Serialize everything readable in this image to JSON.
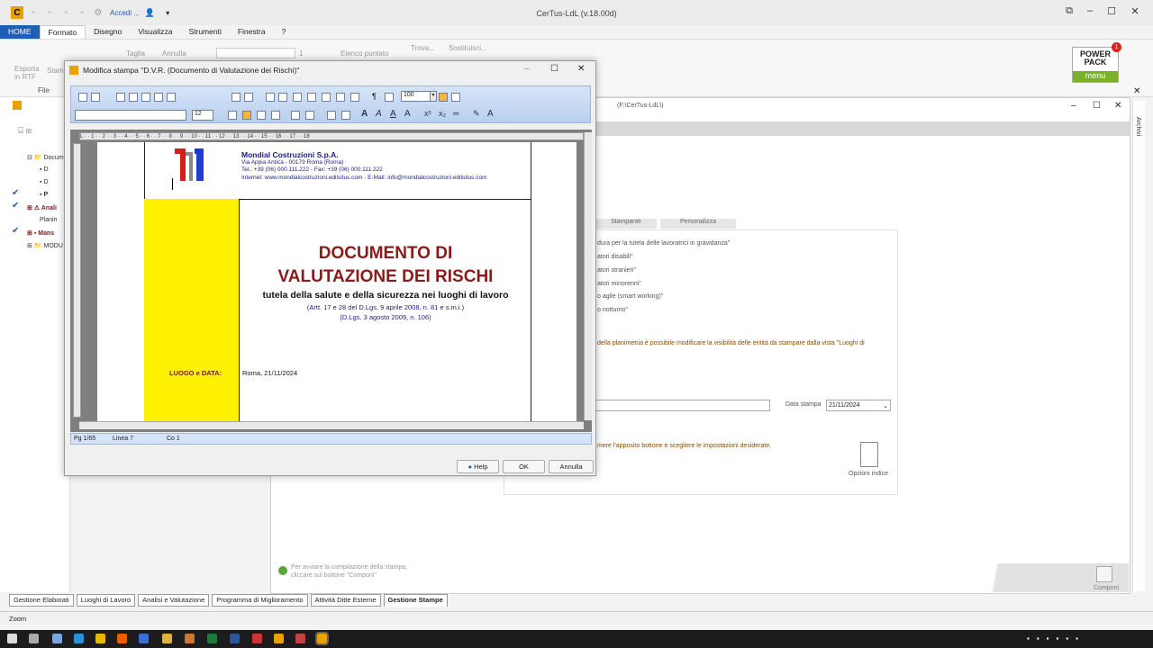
{
  "app": {
    "title": "CerTus-LdL (v.18.00d)",
    "quick_access_label": "Accedi ..."
  },
  "ribbon": {
    "tabs": [
      "HOME",
      "Formato",
      "Disegno",
      "Visualizza",
      "Strumenti",
      "Finestra",
      "?"
    ],
    "items": {
      "esporta": "Esporta\nin RTF",
      "file": "File",
      "stampa": "Stam",
      "taglia": "Taglia",
      "annulla": "Annulla",
      "elenco": "Elenco puntato",
      "trova": "Trova...",
      "sostituisci": "Sostituisci...",
      "spin": "1"
    }
  },
  "power_pack": {
    "line1": "POWER",
    "line2": "PACK",
    "menu": "menu",
    "badge": "1"
  },
  "tree": [
    "Docum",
    "D",
    "D",
    "P",
    "Anali",
    "Planin",
    "Mans",
    "MODU"
  ],
  "bg_window": {
    "path": "(F:\\CerTus-LdL\\)",
    "tabs": [
      "Stampante",
      "Personalizza"
    ],
    "list": [
      "dura per la tutela delle lavoratrici in gravidanza\"",
      "atori disabili\"",
      "atori stranieri\"",
      "atori minorenni\"",
      "o agile (smart working)\"",
      "o notturno\""
    ],
    "note": "della planimetria è possibile modificare la visibilità delle entità da stampare dalla vista \"Luoghi di",
    "date_label": "Data stampa",
    "date_value": "21/11/2024",
    "hint": "mere l'apposito bottone e scegliere le impostazioni desiderate.",
    "index_label": "Opzioni indice",
    "footer1": "Per avviare la compilazione della stampa,",
    "footer2": "cliccare sul bottone \"Componi\"",
    "componi": "Componi"
  },
  "bottom_tabs": [
    "Gestione Elaborati",
    "Luoghi di Lavoro",
    "Analisi e Valutazione",
    "Programma di Miglioramento",
    "Attività Ditte Esterne",
    "Gestione Stampe"
  ],
  "status": {
    "text": "Zoom"
  },
  "right_side": {
    "label": "Archivi"
  },
  "modal": {
    "title": "Modifica stampa  \"D.V.R. (Documento di Valutazione dei Rischi)\"",
    "zoom": "100",
    "font_size": "12",
    "ruler": "L  ·  ·  1  ·  ·  2  ·  ·  3  ·  ·  4  ·  ·  5  ·  ·  6  ·  ·  7  ·  ·  8  ·  ·  9  ·  ·  10  ·  ·  11  ·  ·  12  ·  ·  13  ·  ·  14  ·  ·  15  ·  ·  16  ·  ·  17  ·  ·  18",
    "company": {
      "name": "Mondial Costruzioni S.p.A.",
      "address": "Via Appia Antica - 00179 Roma (Roma)",
      "phone": "Tel.: +39 (06) 000.111.222 - Fax: +39 (06) 000.111.222",
      "web": "Internet: www.mondialcostruzioni.edilsitus.com - E-Mail: info@mondialcostruzioni.edilsitus.com"
    },
    "doc": {
      "title1": "DOCUMENTO DI",
      "title2": "VALUTAZIONE DEI RISCHI",
      "subtitle": "tutela della salute e della sicurezza nei luoghi di lavoro",
      "ref1": "(Artt. 17 e 28 del D.Lgs. 9 aprile 2008, n. 81 e s.m.i.)",
      "ref2": "(D.Lgs. 3 agosto 2009, n. 106)",
      "place_label": "LUOGO e DATA:",
      "place_value": "Roma, 21/11/2024"
    },
    "status": {
      "page": "Pg 1/65",
      "line": "Linea 7",
      "col": "Co 1"
    },
    "buttons": {
      "help": "Help",
      "ok": "OK",
      "cancel": "Annulla"
    },
    "colors": {
      "title_red": "#8b1a1a",
      "yellow": "#fff200",
      "toolbar": "#c5d8f1"
    }
  }
}
